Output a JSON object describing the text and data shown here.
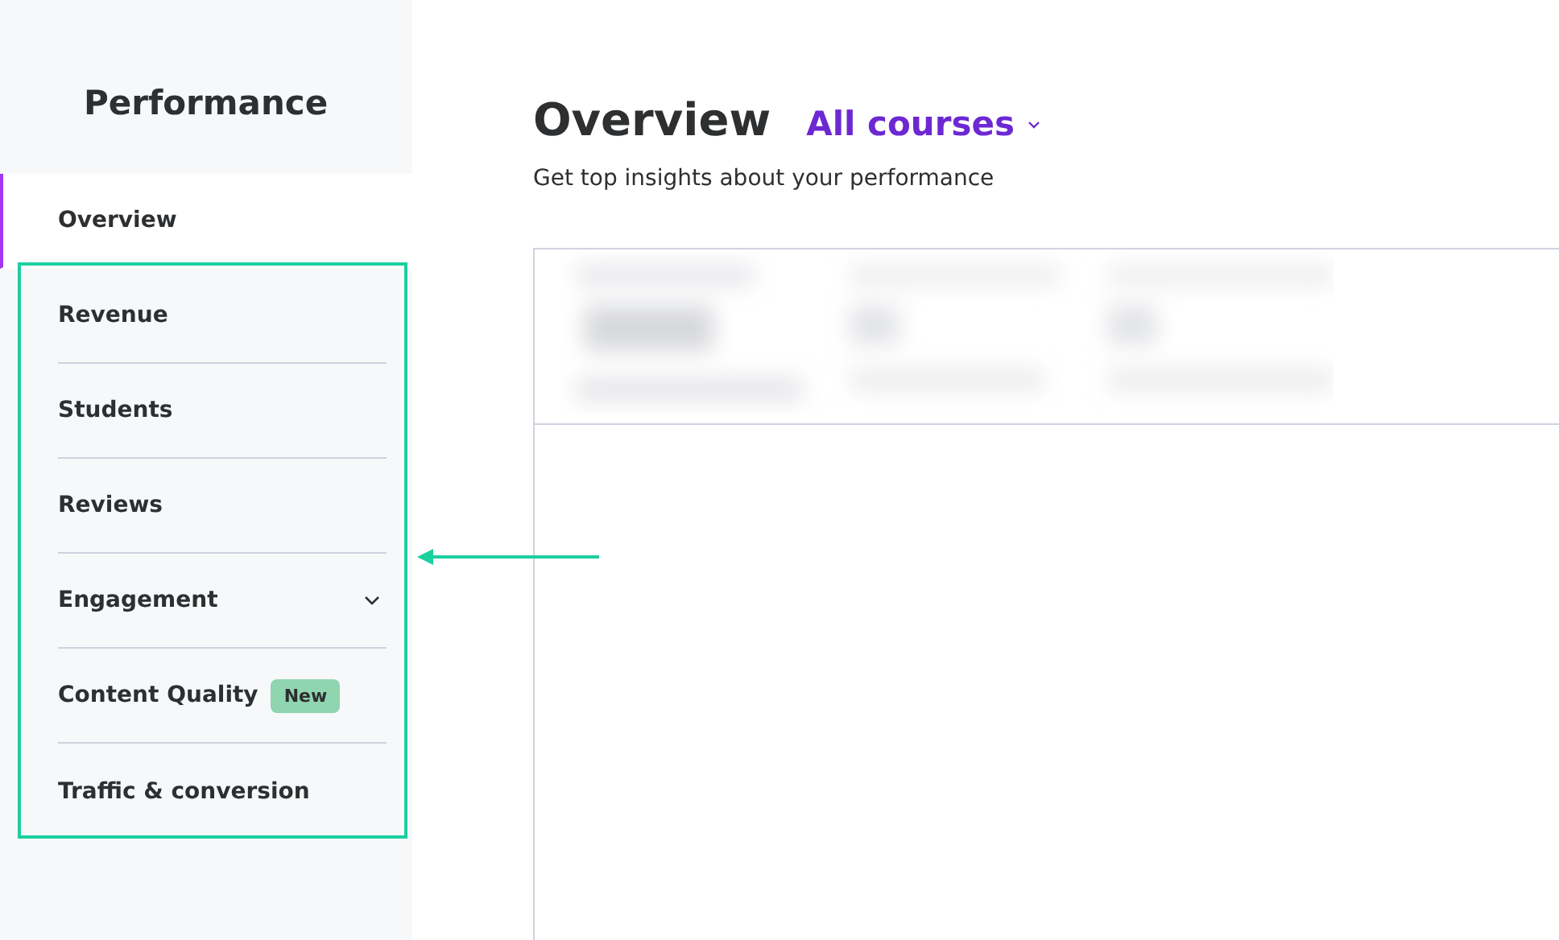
{
  "sidebar": {
    "title": "Performance",
    "items": [
      {
        "label": "Overview",
        "selected": true,
        "kind": "link"
      },
      {
        "label": "Revenue",
        "selected": false,
        "kind": "link"
      },
      {
        "label": "Students",
        "selected": false,
        "kind": "link"
      },
      {
        "label": "Reviews",
        "selected": false,
        "kind": "link"
      },
      {
        "label": "Engagement",
        "selected": false,
        "kind": "dropdown"
      },
      {
        "label": "Content Quality",
        "selected": false,
        "kind": "link",
        "badge": "New"
      },
      {
        "label": "Traffic & conversion",
        "selected": false,
        "kind": "link"
      }
    ]
  },
  "callout": {
    "kind": "box-and-arrow"
  },
  "main": {
    "title": "Overview",
    "course_filter": "All courses",
    "subtitle": "Get top insights about your performance"
  }
}
